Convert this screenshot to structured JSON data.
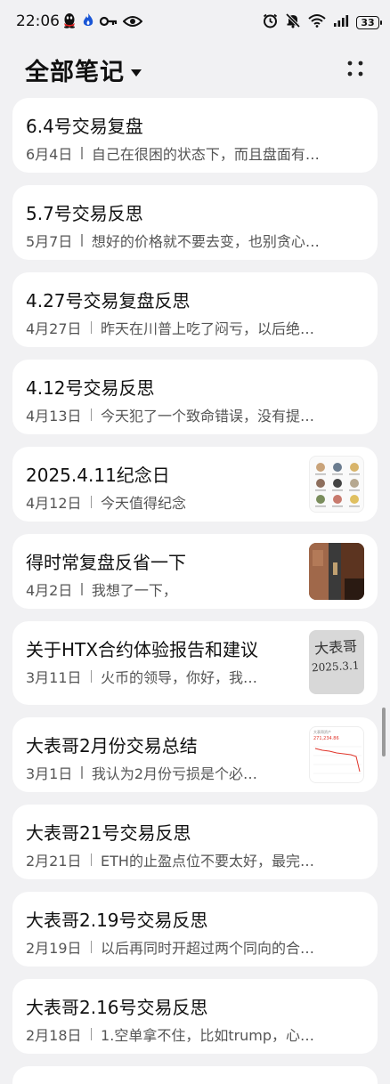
{
  "status": {
    "time": "22:06",
    "battery": "33",
    "left_icons": [
      "qq-icon",
      "flame-icon",
      "key-icon",
      "eye-icon"
    ],
    "right_icons": [
      "alarm-icon",
      "mute-icon",
      "wifi-icon",
      "signal-icon"
    ]
  },
  "header": {
    "title": "全部笔记"
  },
  "notes": [
    {
      "title": "6.4号交易复盘",
      "date": "6月4日",
      "preview": "自己在很困的状态下，而且盘面有…"
    },
    {
      "title": "5.7号交易反思",
      "date": "5月7日",
      "preview": "想好的价格就不要去变，也别贪心…"
    },
    {
      "title": "4.27号交易复盘反思",
      "date": "4月27日",
      "preview": "昨天在川普上吃了闷亏，以后绝…"
    },
    {
      "title": "4.12号交易反思",
      "date": "4月13日",
      "preview": "今天犯了一个致命错误，没有提…"
    },
    {
      "title": "2025.4.11纪念日",
      "date": "4月12日",
      "preview": "今天值得纪念",
      "thumb": "grid"
    },
    {
      "title": "得时常复盘反省一下",
      "date": "4月2日",
      "preview": "我想了一下，",
      "thumb": "door"
    },
    {
      "title": "关于HTX合约体验报告和建议",
      "date": "3月11日",
      "preview": "火币的领导，你好，我…",
      "thumb": "handwriting"
    },
    {
      "title": "大表哥2月份交易总结",
      "date": "3月1日",
      "preview": "我认为2月份亏损是个必…",
      "thumb": "chart"
    },
    {
      "title": "大表哥21号交易反思",
      "date": "2月21日",
      "preview": "ETH的止盈点位不要太好，最完…"
    },
    {
      "title": "大表哥2.19号交易反思",
      "date": "2月19日",
      "preview": "以后再同时开超过两个同向的合…"
    },
    {
      "title": "大表哥2.16号交易反思",
      "date": "2月18日",
      "preview": "1.空单拿不住，比如trump，心…"
    }
  ],
  "thumb_handwriting": {
    "line1": "大表哥",
    "line2": "2025.3.1"
  },
  "thumb_chart": {
    "header": "大表哥资产",
    "value": "271,234.86"
  }
}
